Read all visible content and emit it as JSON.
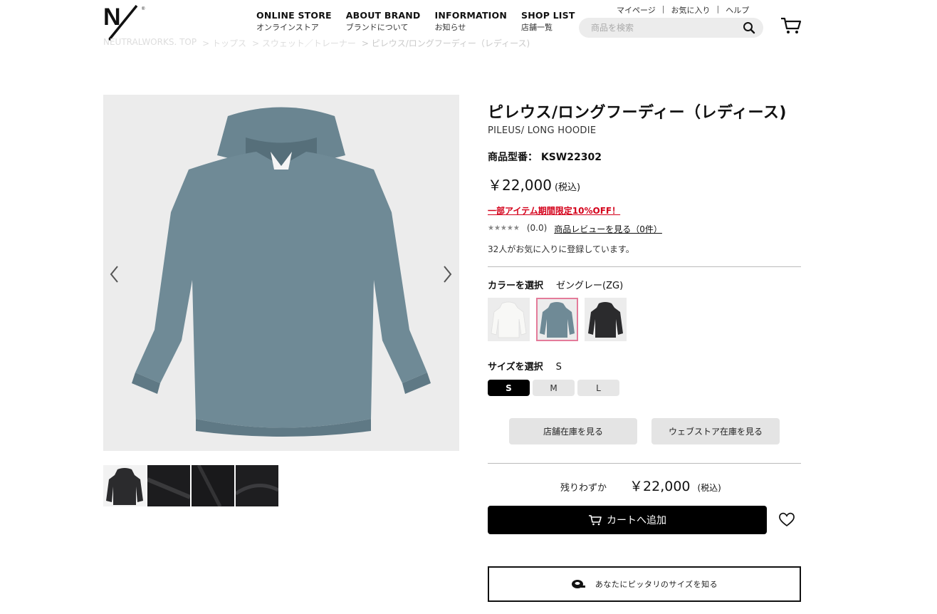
{
  "header": {
    "logo_icon": "ny-logo",
    "nav": [
      {
        "en": "ONLINE STORE",
        "ja": "オンラインストア"
      },
      {
        "en": "ABOUT BRAND",
        "ja": "ブランドについて"
      },
      {
        "en": "INFORMATION",
        "ja": "お知らせ"
      },
      {
        "en": "SHOP LIST",
        "ja": "店舗一覧"
      }
    ],
    "utility": {
      "mypage": "マイページ",
      "favorites": "お気に入り",
      "help": "ヘルプ",
      "separator": "|"
    },
    "search_placeholder": "商品を検索",
    "search_icon": "search-icon",
    "cart_icon": "cart-icon"
  },
  "breadcrumb": [
    "NEUTRALWORKS. TOP",
    "> トップス",
    "> スウェット／トレーナー",
    "> ピレウス/ロングフーディー（レディース)"
  ],
  "gallery": {
    "prev_icon": "chevron-left-icon",
    "next_icon": "chevron-right-icon"
  },
  "product": {
    "title": "ピレウス/ロングフーディー（レディース)",
    "subtitle": "PILEUS/ LONG HOODIE",
    "model_label": "商品型番：",
    "model_number": "KSW22302",
    "price": "￥22,000",
    "tax_note": "(税込)",
    "sale_text": "一部アイテム期間限定10%OFF！",
    "stars": "★★★★★",
    "rating": "(0.0)",
    "review_link": "商品レビューを見る（0件）",
    "favorite_count_text": "32人がお気に入りに登録しています。",
    "color_label": "カラーを選択",
    "color_selected": "ゼングレー(ZG)",
    "colors": [
      {
        "name": "white",
        "hex": "#f4f4f2"
      },
      {
        "name": "zen-gray",
        "hex": "#6f8a96"
      },
      {
        "name": "black",
        "hex": "#2b2b2d"
      }
    ],
    "selected_color_index": 1,
    "size_label": "サイズを選択",
    "size_selected": "S",
    "sizes": [
      "S",
      "M",
      "L"
    ],
    "store_stock_button": "店舗在庫を見る",
    "web_stock_button": "ウェブストア在庫を見る",
    "stock_status": "残りわずか",
    "buy_price": "￥22,000",
    "buy_tax_note": "(税込)",
    "add_to_cart": "カートへ追加",
    "add_to_cart_icon": "cart-icon",
    "favorite_icon": "heart-icon",
    "fit_button": "あなたにピッタリのサイズを知る",
    "fit_icon": "measuring-tape-icon"
  },
  "colors": {
    "accent_sale": "#d4001a",
    "selected_border": "#e47b9a",
    "hoodie_main": "#6f8a96"
  }
}
